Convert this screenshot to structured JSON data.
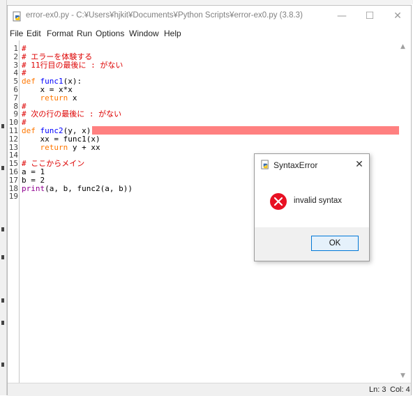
{
  "window": {
    "title": "error-ex0.py - C:¥Users¥hjkit¥Documents¥Python Scripts¥error-ex0.py (3.8.3)",
    "minimize_glyph": "—",
    "maximize_glyph": "☐",
    "close_glyph": "✕"
  },
  "menu": {
    "items": [
      "File",
      "Edit",
      "Format",
      "Run",
      "Options",
      "Window",
      "Help"
    ]
  },
  "editor": {
    "line_numbers": [
      "1",
      "2",
      "3",
      "4",
      "5",
      "6",
      "7",
      "8",
      "9",
      "10",
      "11",
      "12",
      "13",
      "14",
      "15",
      "16",
      "17",
      "18",
      "19"
    ],
    "lines": [
      [
        {
          "t": "#",
          "c": "cm"
        }
      ],
      [
        {
          "t": "# エラーを体験する",
          "c": "cm"
        }
      ],
      [
        {
          "t": "# 11行目の最後に : がない",
          "c": "cm"
        }
      ],
      [
        {
          "t": "#",
          "c": "cm"
        }
      ],
      [
        {
          "t": "def",
          "c": "kw"
        },
        {
          "t": " ",
          "c": ""
        },
        {
          "t": "func1",
          "c": "def"
        },
        {
          "t": "(x):",
          "c": ""
        }
      ],
      [
        {
          "t": "    x = x*x",
          "c": ""
        }
      ],
      [
        {
          "t": "    ",
          "c": ""
        },
        {
          "t": "return",
          "c": "kw"
        },
        {
          "t": " x",
          "c": ""
        }
      ],
      [
        {
          "t": "#",
          "c": "cm"
        }
      ],
      [
        {
          "t": "# 次の行の最後に : がない",
          "c": "cm"
        }
      ],
      [
        {
          "t": "#",
          "c": "cm"
        }
      ],
      [
        {
          "t": "def",
          "c": "kw"
        },
        {
          "t": " ",
          "c": ""
        },
        {
          "t": "func2",
          "c": "def"
        },
        {
          "t": "(y, x)",
          "c": ""
        }
      ],
      [
        {
          "t": "    xx = func1(x)",
          "c": ""
        }
      ],
      [
        {
          "t": "    ",
          "c": ""
        },
        {
          "t": "return",
          "c": "kw"
        },
        {
          "t": " y + xx",
          "c": ""
        }
      ],
      [],
      [
        {
          "t": "# ここからメイン",
          "c": "cm"
        }
      ],
      [
        {
          "t": "a = 1",
          "c": ""
        }
      ],
      [
        {
          "t": "b = 2",
          "c": ""
        }
      ],
      [
        {
          "t": "print",
          "c": "bi"
        },
        {
          "t": "(a, b, func2(a, b))",
          "c": ""
        }
      ],
      []
    ],
    "error_line": 11,
    "colors": {
      "keyword": "#ff7700",
      "builtin": "#900090",
      "definition": "#0000ff",
      "comment": "#dd0000",
      "error_highlight": "#ff8080"
    }
  },
  "statusbar": {
    "line": "Ln: 3",
    "col": "Col: 4"
  },
  "dialog": {
    "title": "SyntaxError",
    "message": "invalid syntax",
    "ok_label": "OK",
    "close_glyph": "✕",
    "icon": "error-icon"
  },
  "scrollbar": {
    "up_glyph": "▲",
    "down_glyph": "▼"
  }
}
